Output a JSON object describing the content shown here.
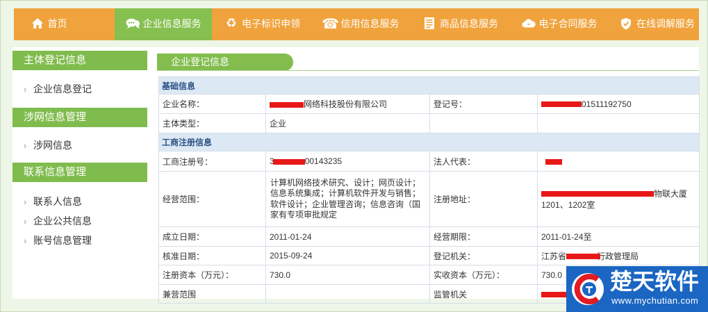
{
  "nav": {
    "items": [
      {
        "label": "首页",
        "icon": "home-icon"
      },
      {
        "label": "企业信息服务",
        "icon": "chat-icon",
        "active": true
      },
      {
        "label": "电子标识申领",
        "icon": "recycle-icon"
      },
      {
        "label": "信用信息服务",
        "icon": "phone-icon"
      },
      {
        "label": "商品信息服务",
        "icon": "document-icon"
      },
      {
        "label": "电子合同服务",
        "icon": "cloud-icon"
      },
      {
        "label": "在线调解服务",
        "icon": "shield-icon"
      }
    ]
  },
  "sidebar": {
    "sections": [
      {
        "title": "主体登记信息",
        "items": [
          "企业信息登记"
        ]
      },
      {
        "title": "涉网信息管理",
        "items": [
          "涉网信息"
        ]
      },
      {
        "title": "联系信息管理",
        "items": [
          "联系人信息",
          "企业公共信息",
          "账号信息管理"
        ]
      }
    ]
  },
  "main": {
    "tab": "企业登记信息",
    "basic_info": {
      "title": "基础信息",
      "company_name_label": "企业名称：",
      "company_name_value": "网络科技股份有限公司",
      "registration_no_label": "登记号：",
      "registration_no_value": "01511192750",
      "entity_type_label": "主体类型：",
      "entity_type_value": "企业"
    },
    "registration_info": {
      "title": "工商注册信息",
      "reg_number_label": "工商注册号：",
      "reg_number_prefix": "3",
      "reg_number_value": "00143235",
      "legal_rep_label": "法人代表：",
      "business_scope_label": "经营范围：",
      "business_scope_value": "计算机网络技术研究、设计；网页设计；信息系统集成；计算机软件开发与销售；软件设计；企业管理咨询；信息咨询（国家有专项审批规定",
      "address_label": "注册地址：",
      "address_line1": "物联大厦",
      "address_line2": "1201、1202室",
      "established_label": "成立日期：",
      "established_value": "2011-01-24",
      "term_label": "经营期限：",
      "term_value": "2011-01-24至",
      "approved_label": "核准日期：",
      "approved_value": "2015-09-24",
      "authority_label": "登记机关：",
      "authority_prefix": "江苏省",
      "authority_suffix": "行政管理局",
      "registered_capital_label": "注册资本（万元）：",
      "registered_capital_value": "730.0",
      "paid_capital_label": "实收资本（万元）：",
      "paid_capital_value": "730.0",
      "secondary_scope_label": "兼营范围",
      "supervisor_label": "监管机关"
    }
  },
  "watermark": {
    "brand": "楚天软件",
    "url": "www.mychutian.com"
  },
  "colors": {
    "nav_bg": "#f0a33c",
    "active_green": "#86c050",
    "section_bg": "#dce8f4",
    "redaction": "#e81818",
    "watermark_bg": "#1a66c2"
  }
}
